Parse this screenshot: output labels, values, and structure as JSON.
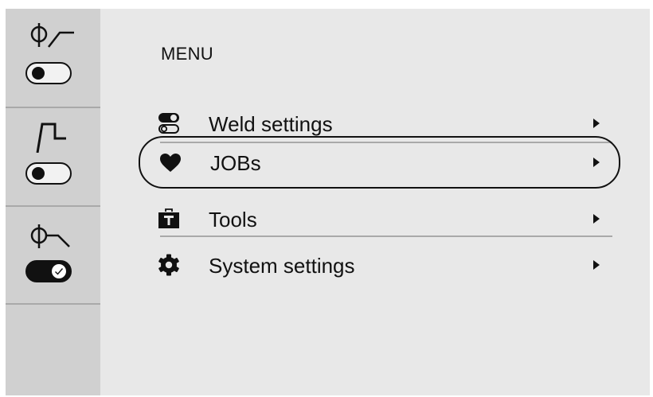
{
  "sidebar": {
    "items": [
      {
        "icon": "torch-wire-feed-icon",
        "toggle": "off"
      },
      {
        "icon": "pulse-curve-icon",
        "toggle": "off"
      },
      {
        "icon": "torch-wire-stop-icon",
        "toggle": "on"
      }
    ]
  },
  "menu": {
    "title": "MENU",
    "items": [
      {
        "label": "Weld settings",
        "icon": "toggle-settings-icon"
      },
      {
        "label": "JOBs",
        "icon": "heart-icon",
        "selected": true
      },
      {
        "label": "Tools",
        "icon": "toolbox-icon"
      },
      {
        "label": "System settings",
        "icon": "gear-icon"
      }
    ]
  }
}
